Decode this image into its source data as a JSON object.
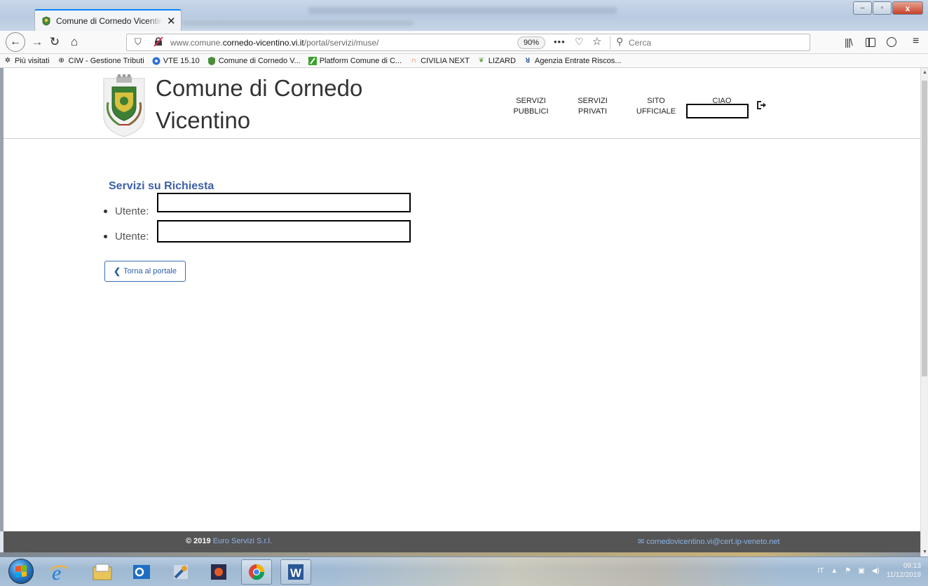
{
  "browser": {
    "tab_title": "Comune di Cornedo Vicentino",
    "tab_close": "✕",
    "url_prefix": "www.comune.",
    "url_domain": "cornedo-vicentino.vi.it",
    "url_path": "/portal/servizi/muse/",
    "zoom": "90%",
    "more": "•••",
    "search_placeholder": "Cerca",
    "window_min": "–",
    "window_max": "▫",
    "window_close": "x"
  },
  "bookmarks": [
    {
      "icon": "gear-icon",
      "label": "Più visitati"
    },
    {
      "icon": "globe-icon",
      "label": "CIW - Gestione Tributi"
    },
    {
      "icon": "vte-icon",
      "label": "VTE 15.10"
    },
    {
      "icon": "crest-icon",
      "label": "Comune di Cornedo V..."
    },
    {
      "icon": "platform-icon",
      "label": "Platform Comune di C..."
    },
    {
      "icon": "civilia-icon",
      "label": "CIVILIA NEXT"
    },
    {
      "icon": "lizard-icon",
      "label": "LIZARD"
    },
    {
      "icon": "ade-icon",
      "label": "Agenzia Entrate Riscos..."
    }
  ],
  "site": {
    "title_line1": "Comune di Cornedo",
    "title_line2": "Vicentino",
    "nav": {
      "servizi_pubblici_1": "SERVIZI",
      "servizi_pubblici_2": "PUBBLICI",
      "servizi_privati_1": "SERVIZI",
      "servizi_privati_2": "PRIVATI",
      "sito_ufficiale_1": "SITO",
      "sito_ufficiale_2": "UFFICIALE",
      "ciao": "CIAO"
    }
  },
  "main": {
    "section_title": "Servizi su Richiesta",
    "items": [
      {
        "label": "Utente:"
      },
      {
        "label": "Utente:"
      }
    ],
    "back_button": "Torna al portale"
  },
  "footer": {
    "copyright": "© 2019",
    "company": "Euro Servizi S.r.l.",
    "email": "cornedovicentino.vi@cert.ip-veneto.net"
  },
  "taskbar": {
    "lang": "IT",
    "time": "09:13",
    "date": "11/12/2019"
  },
  "colors": {
    "accent": "#3c5fa8",
    "footer_bg": "#555555",
    "tab_accent": "#0a84ff"
  }
}
